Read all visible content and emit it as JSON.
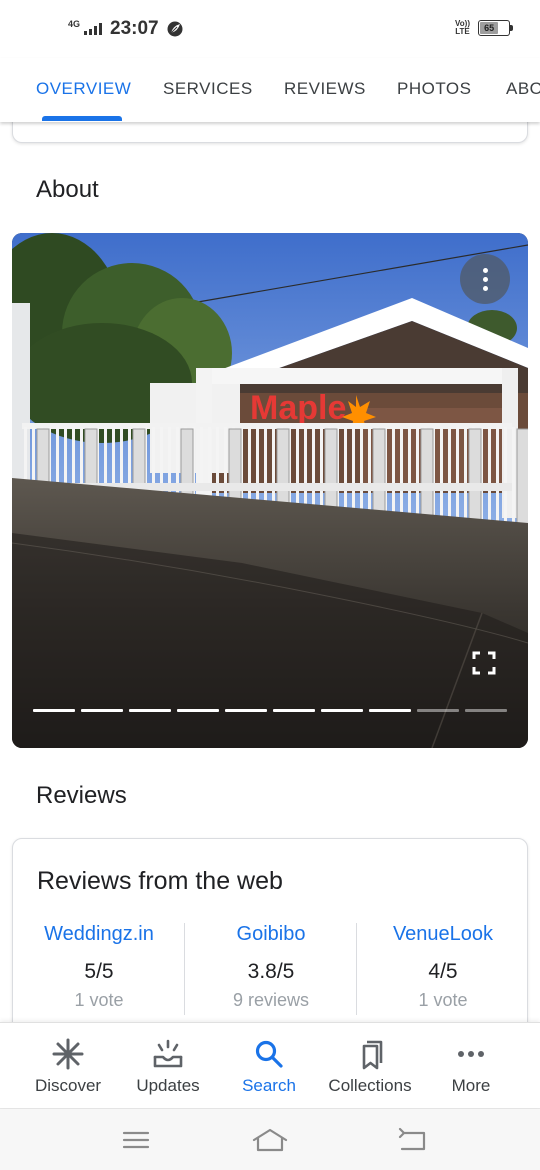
{
  "status_bar": {
    "network": "4G",
    "time": "23:07",
    "volte": [
      "Vo))",
      "LTE"
    ],
    "battery": "65",
    "battery_level_percent": 65
  },
  "tabs": [
    {
      "label": "OVERVIEW",
      "active": true
    },
    {
      "label": "SERVICES",
      "active": false
    },
    {
      "label": "REVIEWS",
      "active": false
    },
    {
      "label": "PHOTOS",
      "active": false
    },
    {
      "label": "ABO",
      "active": false
    }
  ],
  "about": {
    "title": "About",
    "photo": {
      "sign_text": "Maple",
      "sign_color": "#e53935",
      "leaf_color": "#ff8f00",
      "carousel": {
        "total": 10,
        "viewed": 8
      }
    }
  },
  "reviews": {
    "title": "Reviews",
    "card_title": "Reviews from the web",
    "sources": [
      {
        "name": "Weddingz.in",
        "score": "5/5",
        "count": "1 vote"
      },
      {
        "name": "Goibibo",
        "score": "3.8/5",
        "count": "9 reviews"
      },
      {
        "name": "VenueLook",
        "score": "4/5",
        "count": "1 vote"
      }
    ]
  },
  "bottom_nav": [
    {
      "label": "Discover",
      "icon": "asterisk-icon",
      "active": false
    },
    {
      "label": "Updates",
      "icon": "updates-icon",
      "active": false
    },
    {
      "label": "Search",
      "icon": "search-icon",
      "active": true
    },
    {
      "label": "Collections",
      "icon": "bookmarks-icon",
      "active": false
    },
    {
      "label": "More",
      "icon": "more-horiz-icon",
      "active": false
    }
  ],
  "colors": {
    "accent": "#1a73e8",
    "text_primary": "#202124",
    "text_secondary": "#3c4043",
    "text_muted": "#9aa0a6"
  }
}
